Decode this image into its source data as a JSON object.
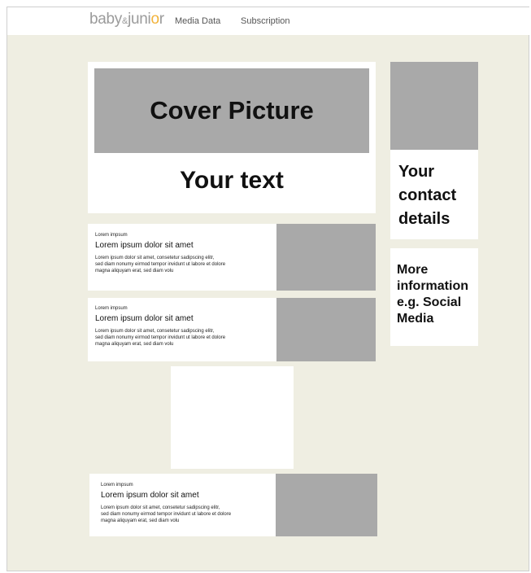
{
  "header": {
    "logo_baby": "baby",
    "logo_amp": "&",
    "logo_juni": "juni",
    "logo_o": "o",
    "logo_r": "r",
    "nav": [
      "Media Data",
      "Subscription"
    ]
  },
  "cover": {
    "picture_label": "Cover Picture",
    "text_label": "Your text"
  },
  "sidebar": {
    "contact_lines": [
      "Your",
      "contact",
      "details"
    ],
    "more_lines": [
      "More",
      "information",
      "e.g. Social",
      "Media"
    ]
  },
  "articles": [
    {
      "kicker": "Lorem impsum",
      "title": "Lorem ipsum dolor sit amet",
      "body": "Lorem ipsum dolor sit amet, consetetur sadipscing elitr,\nsed diam nonumy eirmod tempor invidunt ut labore et dolore\nmagna aliquyam erat, sed diam volu"
    },
    {
      "kicker": "Lorem impsum",
      "title": "Lorem ipsum dolor sit amet",
      "body": "Lorem ipsum dolor sit amet, consetetur sadipscing elitr,\nsed diam nonumy eirmod tempor invidunt ut labore et dolore\nmagna aliquyam erat, sed diam volu"
    },
    {
      "kicker": "Lorem impsum",
      "title": "Lorem ipsum dolor sit amet",
      "body": "Lorem ipsum dolor sit amet, consetetur sadipscing elitr,\nsed diam nonumy eirmod tempor invidunt ut labore et dolore\nmagna aliquyam erat, sed diam volu"
    }
  ],
  "colors": {
    "page_background": "#efeee2",
    "placeholder_gray": "#a9a9a9",
    "logo_gray": "#9b9b9b",
    "logo_accent": "#f2b33a"
  }
}
